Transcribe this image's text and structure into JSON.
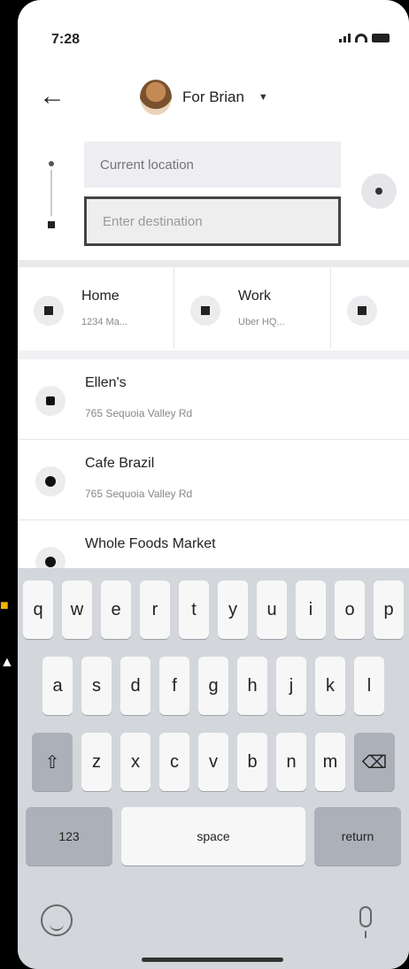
{
  "status": {
    "time": "7:28"
  },
  "header": {
    "rider_label": "For Brian"
  },
  "route": {
    "pickup_placeholder": "Current location",
    "destination_placeholder": "Enter destination"
  },
  "shortcuts": [
    {
      "title": "Home",
      "subtitle": "1234 Ma..."
    },
    {
      "title": "Work",
      "subtitle": "Uber HQ..."
    },
    {
      "title": ""
    }
  ],
  "results": [
    {
      "title": "Ellen's",
      "subtitle": "765 Sequoia Valley Rd",
      "icon": "star-icon"
    },
    {
      "title": "Cafe Brazil",
      "subtitle": "765 Sequoia Valley Rd",
      "icon": "clock-icon"
    },
    {
      "title": "Whole Foods Market",
      "subtitle": "",
      "icon": "clock-icon"
    }
  ],
  "keyboard": {
    "row1": [
      "q",
      "w",
      "e",
      "r",
      "t",
      "y",
      "u",
      "i",
      "o",
      "p"
    ],
    "row2": [
      "a",
      "s",
      "d",
      "f",
      "g",
      "h",
      "j",
      "k",
      "l"
    ],
    "row3": [
      "z",
      "x",
      "c",
      "v",
      "b",
      "n",
      "m"
    ],
    "numbers": "123",
    "space": "space",
    "return": "return"
  },
  "colors": {
    "accent_text": "#6b84a9",
    "keyboard_bg": "#d3d6db"
  }
}
